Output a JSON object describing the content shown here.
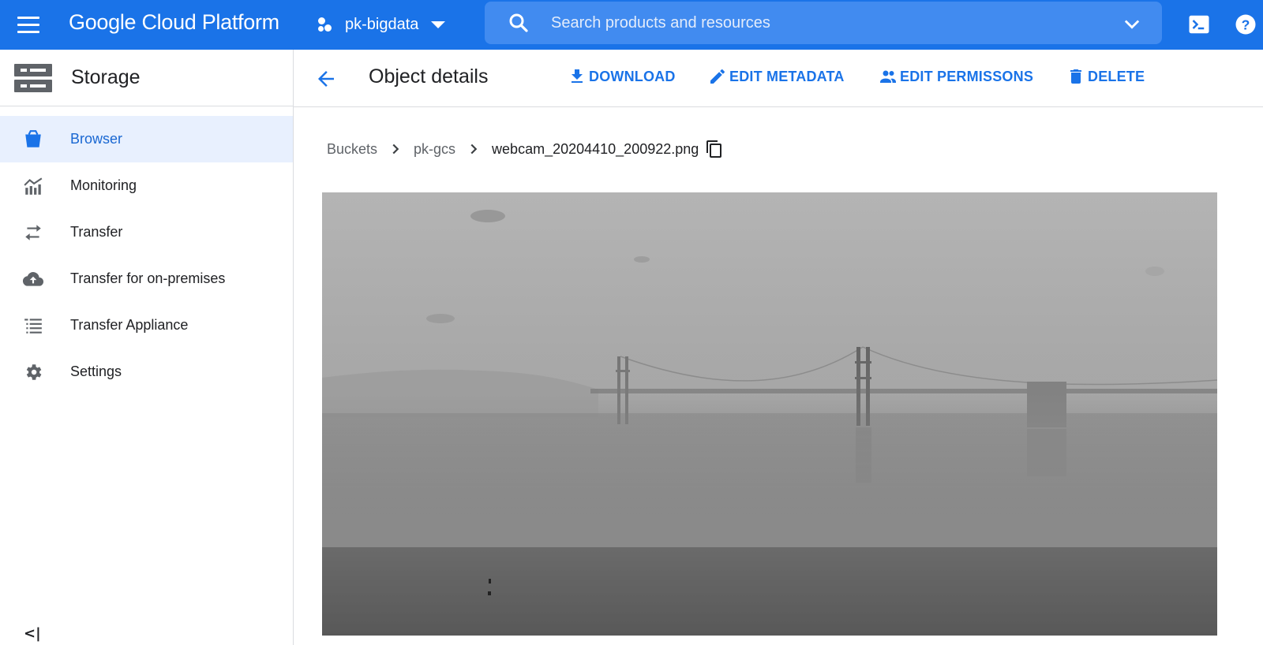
{
  "topbar": {
    "brand": "Google Cloud Platform",
    "project": "pk-bigdata",
    "search_placeholder": "Search products and resources"
  },
  "sidebar": {
    "title": "Storage",
    "items": [
      {
        "label": "Browser",
        "icon": "bucket-icon",
        "active": true
      },
      {
        "label": "Monitoring",
        "icon": "monitoring-chart-icon"
      },
      {
        "label": "Transfer",
        "icon": "swap-arrows-icon"
      },
      {
        "label": "Transfer for on-premises",
        "icon": "cloud-upload-icon"
      },
      {
        "label": "Transfer Appliance",
        "icon": "list-icon"
      },
      {
        "label": "Settings",
        "icon": "gear-icon"
      }
    ],
    "collapse_label": "<|"
  },
  "main": {
    "title": "Object details",
    "actions": {
      "download": "DOWNLOAD",
      "edit_metadata": "EDIT METADATA",
      "edit_permissions": "EDIT PERMISSONS",
      "delete": "DELETE"
    },
    "breadcrumb": {
      "root": "Buckets",
      "bucket": "pk-gcs",
      "object": "webcam_20204410_200922.png"
    }
  },
  "colors": {
    "topbar": "#1a73e8",
    "search_bg": "#418bf0",
    "accent": "#1a73e8",
    "active_bg": "#e8f0fe"
  }
}
